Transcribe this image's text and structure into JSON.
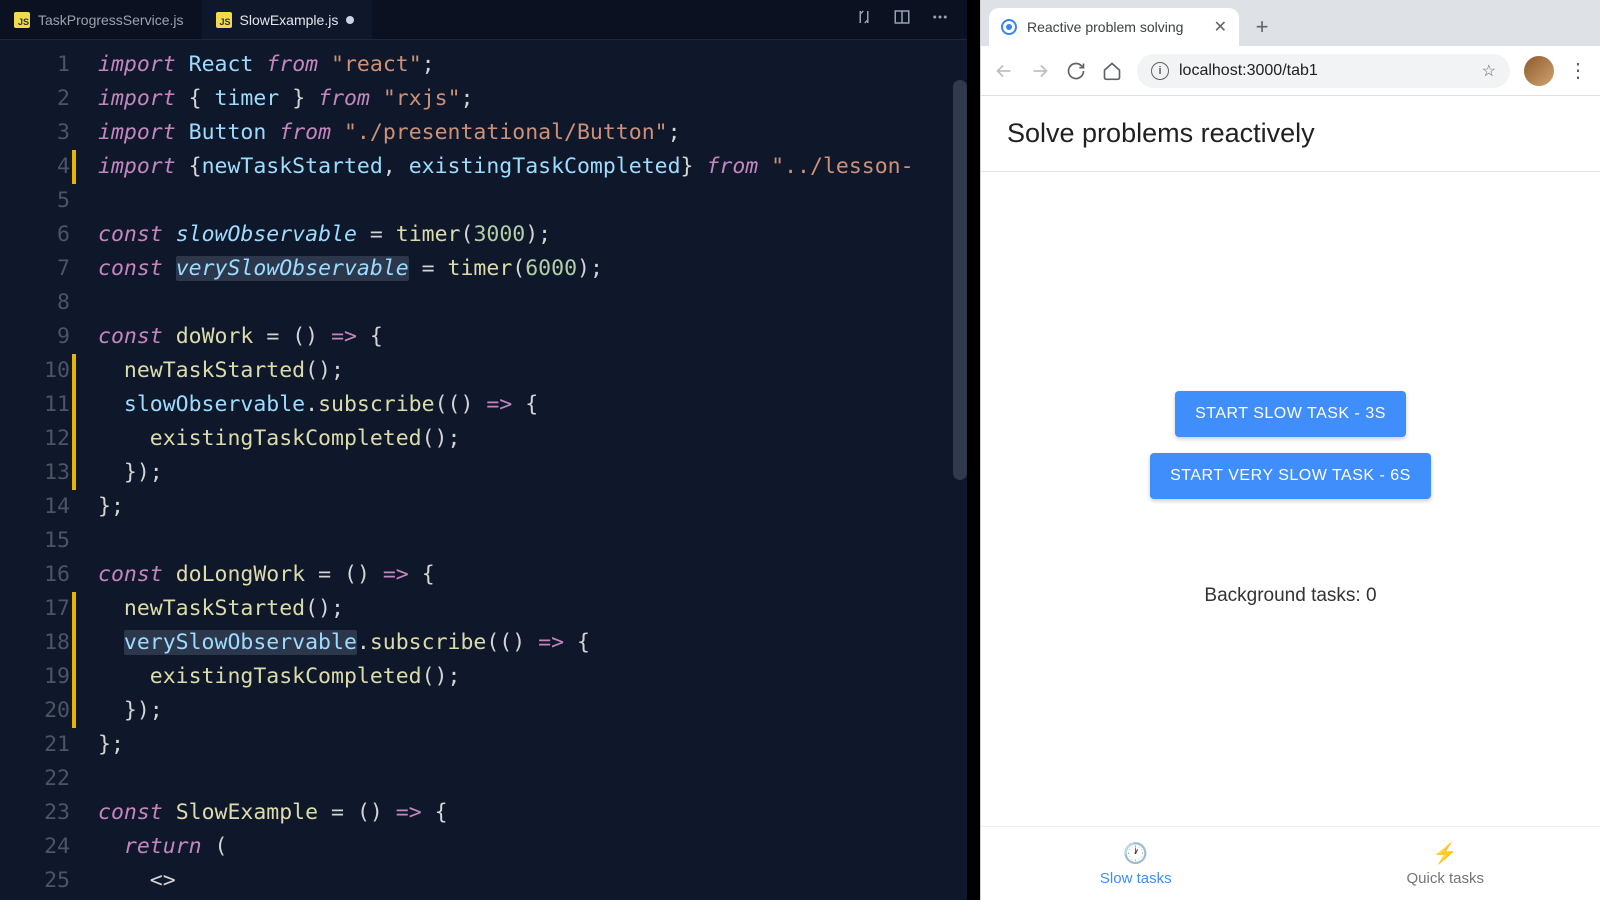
{
  "editor": {
    "tabs": [
      {
        "label": "TaskProgressService.js",
        "active": false,
        "dirty": false
      },
      {
        "label": "SlowExample.js",
        "active": true,
        "dirty": true
      }
    ],
    "code_lines": [
      {
        "n": 1,
        "mod": false,
        "html": "<span class='k'>import</span> <span class='id'>React</span> <span class='k'>from</span> <span class='str'>\"react\"</span><span class='p'>;</span>"
      },
      {
        "n": 2,
        "mod": false,
        "html": "<span class='k'>import</span> <span class='p'>{</span> <span class='id'>timer</span> <span class='p'>}</span> <span class='k'>from</span> <span class='str'>\"rxjs\"</span><span class='p'>;</span>"
      },
      {
        "n": 3,
        "mod": false,
        "html": "<span class='k'>import</span> <span class='id'>Button</span> <span class='k'>from</span> <span class='str'>\"./presentational/Button\"</span><span class='p'>;</span>"
      },
      {
        "n": 4,
        "mod": true,
        "html": "<span class='k'>import</span> <span class='p'>{</span><span class='id'>newTaskStarted</span><span class='p'>,</span> <span class='id'>existingTaskCompleted</span><span class='p'>}</span> <span class='k'>from</span> <span class='str'>\"../lesson-</span>"
      },
      {
        "n": 5,
        "mod": false,
        "html": ""
      },
      {
        "n": 6,
        "mod": false,
        "html": "<span class='k'>const</span> <span class='def'>slowObservable</span> <span class='p'>=</span> <span class='fn'>timer</span><span class='p'>(</span><span class='num'>3000</span><span class='p'>);</span>"
      },
      {
        "n": 7,
        "mod": false,
        "html": "<span class='k'>const</span> <span class='def hl'>verySlowObservable</span> <span class='p'>=</span> <span class='fn'>timer</span><span class='p'>(</span><span class='num'>6000</span><span class='p'>);</span>"
      },
      {
        "n": 8,
        "mod": false,
        "html": ""
      },
      {
        "n": 9,
        "mod": false,
        "html": "<span class='k'>const</span> <span class='fn'>doWork</span> <span class='p'>=</span> <span class='p'>()</span> <span class='op'>=&gt;</span> <span class='p'>{</span>"
      },
      {
        "n": 10,
        "mod": true,
        "html": "  <span class='fn'>newTaskStarted</span><span class='p'>();</span>"
      },
      {
        "n": 11,
        "mod": true,
        "html": "  <span class='id'>slowObservable</span><span class='p'>.</span><span class='fn'>subscribe</span><span class='p'>(()</span> <span class='op'>=&gt;</span> <span class='p'>{</span>"
      },
      {
        "n": 12,
        "mod": true,
        "html": "    <span class='fn'>existingTaskCompleted</span><span class='p'>();</span>"
      },
      {
        "n": 13,
        "mod": true,
        "html": "  <span class='p'>});</span>"
      },
      {
        "n": 14,
        "mod": false,
        "html": "<span class='p'>};</span>"
      },
      {
        "n": 15,
        "mod": false,
        "html": ""
      },
      {
        "n": 16,
        "mod": false,
        "html": "<span class='k'>const</span> <span class='fn'>doLongWork</span> <span class='p'>=</span> <span class='p'>()</span> <span class='op'>=&gt;</span> <span class='p'>{</span>"
      },
      {
        "n": 17,
        "mod": true,
        "html": "  <span class='fn'>newTaskStarted</span><span class='p'>();</span>"
      },
      {
        "n": 18,
        "mod": true,
        "html": "  <span class='id hl'>verySlowObservable</span><span class='p'>.</span><span class='fn'>subscribe</span><span class='p'>(()</span> <span class='op'>=&gt;</span> <span class='p'>{</span>"
      },
      {
        "n": 19,
        "mod": true,
        "html": "    <span class='fn'>existingTaskCompleted</span><span class='p'>();</span>"
      },
      {
        "n": 20,
        "mod": true,
        "html": "  <span class='p'>});</span>"
      },
      {
        "n": 21,
        "mod": false,
        "html": "<span class='p'>};</span>"
      },
      {
        "n": 22,
        "mod": false,
        "html": ""
      },
      {
        "n": 23,
        "mod": false,
        "html": "<span class='k'>const</span> <span class='fn'>SlowExample</span> <span class='p'>=</span> <span class='p'>()</span> <span class='op'>=&gt;</span> <span class='p'>{</span>"
      },
      {
        "n": 24,
        "mod": false,
        "html": "  <span class='k'>return</span> <span class='p'>(</span>"
      },
      {
        "n": 25,
        "mod": false,
        "html": "    <span class='p'>&lt;&gt;</span>"
      }
    ]
  },
  "browser": {
    "tab_title": "Reactive problem solving",
    "url": "localhost:3000/tab1",
    "page": {
      "heading": "Solve problems reactively",
      "button1": "START SLOW TASK - 3S",
      "button2": "START VERY SLOW TASK - 6S",
      "status_prefix": "Background tasks: ",
      "status_count": "0",
      "nav": {
        "item1": "Slow tasks",
        "item2": "Quick tasks"
      }
    }
  }
}
